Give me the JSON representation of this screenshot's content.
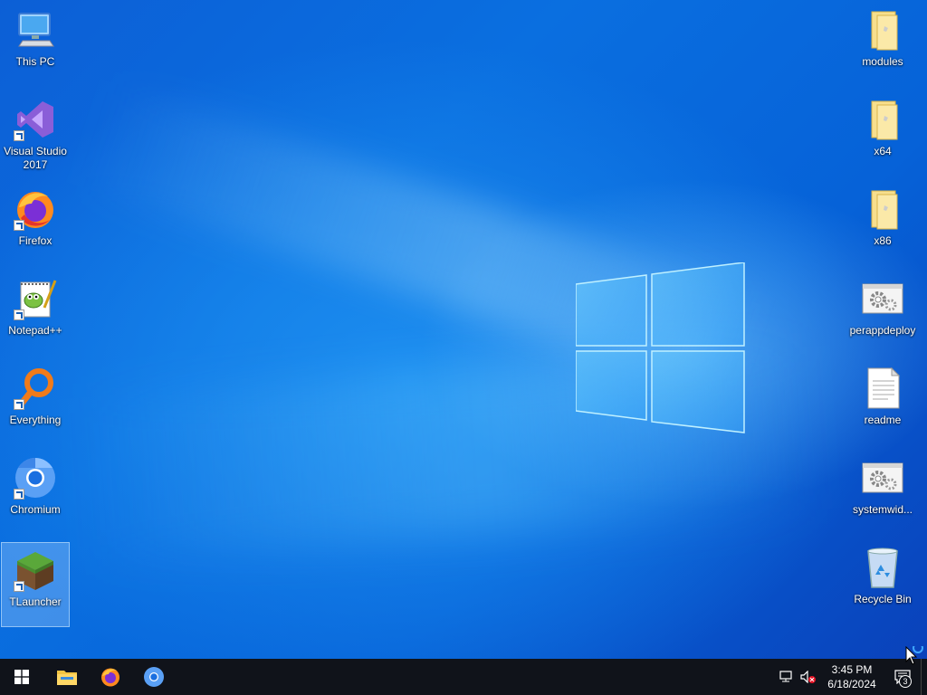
{
  "desktop": {
    "left_icons": [
      {
        "label": "This PC",
        "icon": "this-pc-icon"
      },
      {
        "label": "Visual Studio 2017",
        "icon": "visual-studio-icon"
      },
      {
        "label": "Firefox",
        "icon": "firefox-icon"
      },
      {
        "label": "Notepad++",
        "icon": "notepadpp-icon"
      },
      {
        "label": "Everything",
        "icon": "everything-icon"
      },
      {
        "label": "Chromium",
        "icon": "chromium-icon"
      },
      {
        "label": "TLauncher",
        "icon": "tlauncher-icon"
      }
    ],
    "right_icons": [
      {
        "label": "modules",
        "icon": "folder-icon"
      },
      {
        "label": "x64",
        "icon": "folder-icon"
      },
      {
        "label": "x86",
        "icon": "folder-icon"
      },
      {
        "label": "perappdeploy",
        "icon": "settings-file-icon"
      },
      {
        "label": "readme",
        "icon": "text-file-icon"
      },
      {
        "label": "systemwid...",
        "icon": "settings-file-icon"
      },
      {
        "label": "Recycle Bin",
        "icon": "recycle-bin-icon"
      }
    ],
    "selected_icon": "TLauncher"
  },
  "taskbar": {
    "pinned": [
      {
        "name": "start-button",
        "icon": "windows-icon"
      },
      {
        "name": "file-explorer",
        "icon": "folder-icon"
      },
      {
        "name": "firefox",
        "icon": "firefox-icon"
      },
      {
        "name": "chromium",
        "icon": "chromium-icon"
      }
    ],
    "clock": {
      "time": "3:45 PM",
      "date": "6/18/2024"
    },
    "notification_count": "3"
  },
  "colors": {
    "taskbar": "#10131a",
    "desktop_blue": "#0a6fe0",
    "folder": "#f5d77a"
  }
}
